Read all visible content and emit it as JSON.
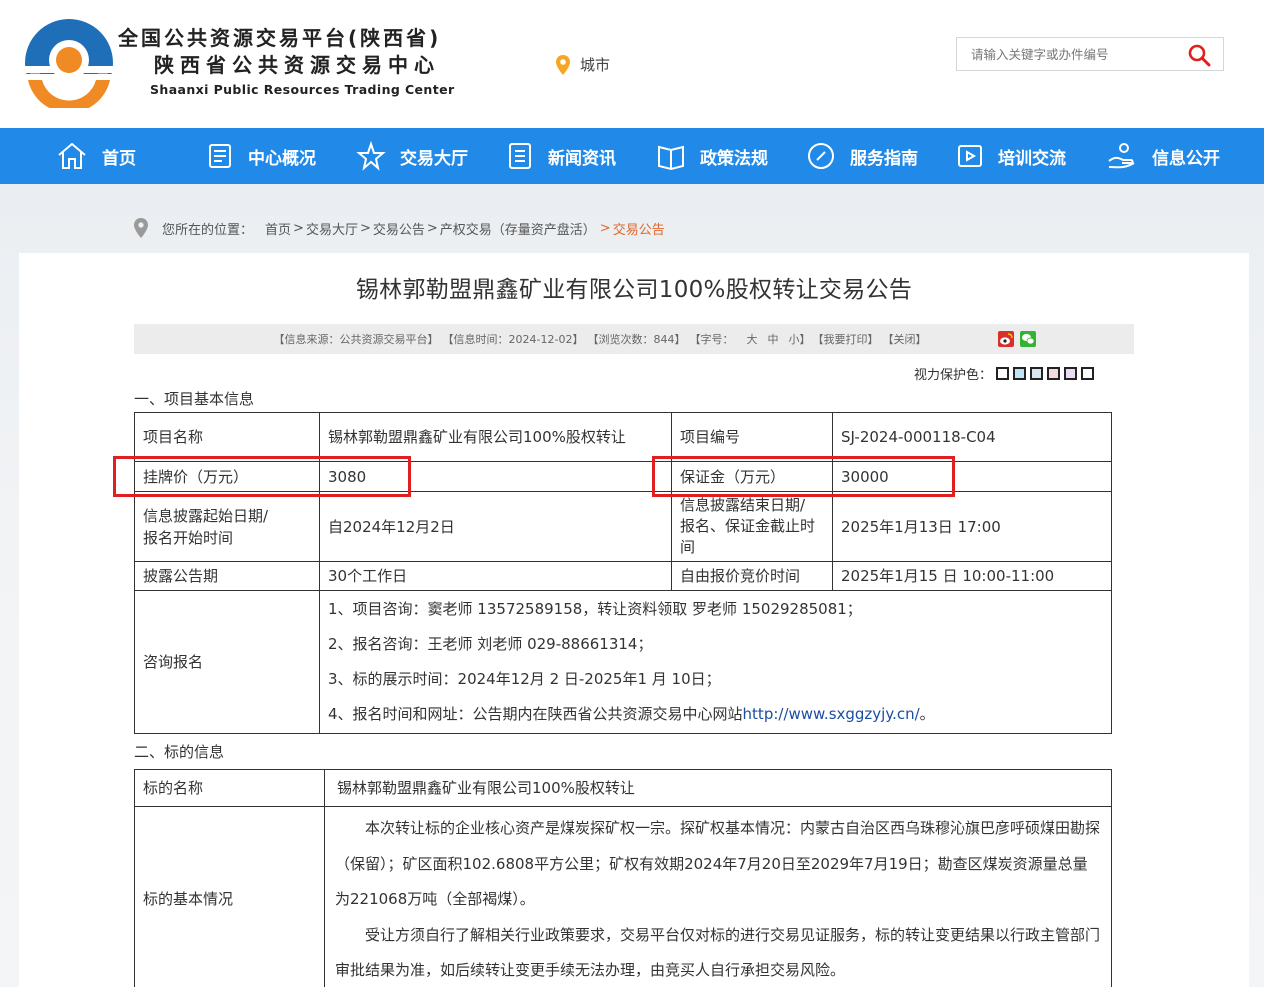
{
  "header": {
    "brand_line1": "全国公共资源交易平台(陕西省)",
    "brand_line2": "陕西省公共资源交易中心",
    "brand_line3": "Shaanxi Public Resources Trading Center",
    "city_label": "城市",
    "search_placeholder": "请输入关键字或办件编号",
    "colors": {
      "nav_bg": "#2189e8",
      "logo_blue": "#1e6fb8",
      "logo_orange": "#f08a24",
      "accent_red": "#e02020"
    }
  },
  "nav": {
    "items": [
      {
        "label": "首页",
        "icon": "home-icon"
      },
      {
        "label": "中心概况",
        "icon": "document-icon"
      },
      {
        "label": "交易大厅",
        "icon": "star-icon"
      },
      {
        "label": "新闻资讯",
        "icon": "list-icon"
      },
      {
        "label": "政策法规",
        "icon": "book-icon"
      },
      {
        "label": "服务指南",
        "icon": "compass-icon"
      },
      {
        "label": "培训交流",
        "icon": "video-icon"
      },
      {
        "label": "信息公开",
        "icon": "hand-icon"
      }
    ]
  },
  "breadcrumb": {
    "prefix": "您所在的位置：",
    "items": [
      "首页",
      "交易大厅",
      "交易公告",
      "产权交易（存量资产盘活）",
      "交易公告"
    ]
  },
  "article": {
    "title": "锡林郭勒盟鼎鑫矿业有限公司100%股权转让交易公告",
    "info": {
      "source": "【信息来源：公共资源交易平台】",
      "time": "【信息时间：2024-12-02】",
      "views": "【浏览次数：844】",
      "font_label": "【字号：",
      "font_sizes": [
        "大",
        "中",
        "小"
      ],
      "font_end": "】",
      "print": "【我要打印】",
      "close": "【关闭】"
    },
    "vision_label": "视力保护色：",
    "vision_colors": [
      "#ffffff",
      "#bfe3f5",
      "#d9e6f0",
      "#f7d9e4",
      "#e7dcf2",
      "#ffffff"
    ],
    "section1": "一、项目基本信息",
    "t1": {
      "r1": {
        "k1": "项目名称",
        "v1": "锡林郭勒盟鼎鑫矿业有限公司100%股权转让",
        "k2": "项目编号",
        "v2": "SJ-2024-000118-C04"
      },
      "r2": {
        "k1": "挂牌价（万元）",
        "v1": "3080",
        "k2": "保证金（万元）",
        "v2": "30000"
      },
      "r3": {
        "k1a": "信息披露起始日期/",
        "k1b": "报名开始时间",
        "v1": "自2024年12月2日",
        "k2a": "信息披露结束日期/",
        "k2b": "报名、保证金截止时",
        "k2c": "间",
        "v2": "2025年1月13日 17:00"
      },
      "r4": {
        "k1": "披露公告期",
        "v1": "30个工作日",
        "k2": "自由报价竞价时间",
        "v2": "2025年1月15 日 10:00-11:00"
      },
      "r5": {
        "k1": "咨询报名",
        "line1": "1、项目咨询：窦老师 13572589158，转让资料领取 罗老师 15029285081；",
        "line2": "2、报名咨询：王老师 刘老师 029-88661314；",
        "line3": "3、标的展示时间：2024年12月 2 日-2025年1 月 10日；",
        "line4_prefix": "4、报名时间和网址：公告期内在陕西省公共资源交易中心网站",
        "line4_link": "http://www.sxggzyjy.cn/",
        "line4_suffix": "。"
      }
    },
    "section2": "二、标的信息",
    "t2": {
      "name_key": "标的名称",
      "name_val": "锡林郭勒盟鼎鑫矿业有限公司100%股权转让",
      "desc_key": "标的基本情况",
      "desc_p1": "本次转让标的企业核心资产是煤炭探矿权一宗。探矿权基本情况：内蒙古自治区西乌珠穆沁旗巴彦呼硕煤田勘探（保留）；矿区面积102.6808平方公里；矿权有效期2024年7月20日至2029年7月19日；勘查区煤炭资源量总量为221068万吨（全部褐煤）。",
      "desc_p2": "受让方须自行了解相关行业政策要求，交易平台仅对标的进行交易见证服务，标的转让变更结果以行政主管部门审批结果为准，如后续转让变更手续无法办理，由竞买人自行承担交易风险。"
    }
  }
}
